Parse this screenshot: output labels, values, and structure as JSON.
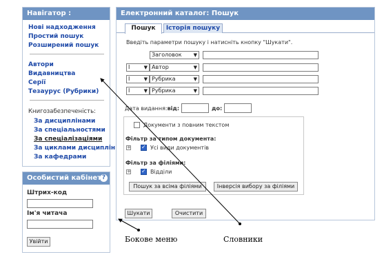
{
  "navigator": {
    "title": "Навігатор :",
    "links": [
      "Нові надходження",
      "Простий пошук",
      "Розширений пошук"
    ],
    "dicts": [
      "Автори",
      "Видавництва",
      "Серії",
      "Тезаурус (Рубрики)"
    ],
    "support_label": "Книгозабезпеченість:",
    "support_links": [
      "За дисциплінами",
      "За спеціальностями",
      "За спеціалізаціями",
      "За циклами дисциплін",
      "За кафедрами"
    ]
  },
  "cabinet": {
    "title": "Особистий кабінет:",
    "barcode_label": "Штрих-код",
    "barcode_value": "",
    "reader_label": "Ім'я читача",
    "reader_value": "",
    "login_button": "Увійти"
  },
  "catalog": {
    "title": "Електронний каталог: Пошук",
    "tabs": [
      "Пошук",
      "Історія пошуку"
    ],
    "instruction": "Введіть параметри пошуку і натисніть кнопку \"Шукати\".",
    "rows": [
      {
        "op": "",
        "field": "Заголовок",
        "value": ""
      },
      {
        "op": "I",
        "field": "Автор",
        "value": ""
      },
      {
        "op": "I",
        "field": "Рубрика",
        "value": ""
      },
      {
        "op": "I",
        "field": "Рубрика",
        "value": ""
      }
    ],
    "date_label": "Дата видання:",
    "from_label": "від:",
    "to_label": "до:",
    "full_text_label": "Документи з повним текстом",
    "doc_type_label": "Фільтр за типом документа:",
    "all_types_label": "Усі види документів",
    "branch_label": "Фільтр за філіями:",
    "branches_label": "Відділи",
    "search_all_button": "Пошук за всіма філіями",
    "invert_button": "Інверсія вибору за філіями",
    "search_button": "Шукати",
    "clear_button": "Очистити"
  },
  "annotations": {
    "side_menu": "Бокове меню",
    "dictionaries": "Словники"
  },
  "colors": {
    "header": "#6f94c3",
    "link": "#1f4aa8",
    "checkbox": "#2e63c7"
  },
  "icons": [
    "help-icon",
    "dropdown-chevron-icon",
    "expand-plus-icon",
    "checkbox-check-icon",
    "arrow-icon"
  ]
}
